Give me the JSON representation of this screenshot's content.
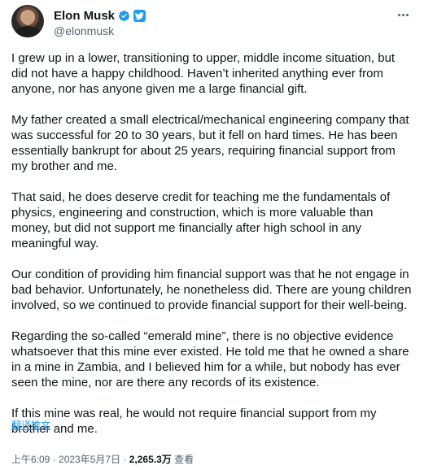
{
  "author": {
    "name": "Elon Musk",
    "handle": "@elonmusk"
  },
  "paragraphs": [
    "I grew up in a lower, transitioning to upper, middle income situation, but did not have a happy childhood. Haven’t inherited anything ever from anyone, nor has anyone given me a large financial gift.",
    "My father created a small electrical/mechanical engineering company that was successful for 20 to 30 years, but it fell on hard times. He has been essentially bankrupt for about 25 years, requiring financial support from my brother and me.",
    "That said, he does deserve credit for teaching me the fundamentals of physics, engineering and construction, which is more valuable than money, but did not support me financially after high school in any meaningful way.",
    "Our condition of providing him financial support was that he not engage in bad behavior. Unfortunately, he nonetheless did. There are young children involved, so we continued to provide financial support for their well-being.",
    "Regarding the so-called “emerald mine”, there is no objective evidence whatsoever that this mine ever existed. He told me that he owned a share in a mine in Zambia, and I believed him for a while, but nobody has ever seen the mine, nor are there any records of its existence.",
    "If this mine was real, he would not require financial support from my brother and me."
  ],
  "translate_label": "翻译推文",
  "meta": {
    "time": "上午6:09",
    "sep1": " · ",
    "date": "2023年5月7日",
    "sep2": " · ",
    "views_count": "2,265.3万",
    "views_label": " 查看"
  },
  "icons": {
    "verified": "verified-badge-icon",
    "twitter": "twitter-bird-icon",
    "more": "more-options-icon"
  },
  "colors": {
    "accent": "#1d9bf0",
    "text": "#0f1419",
    "secondary": "#536471"
  }
}
